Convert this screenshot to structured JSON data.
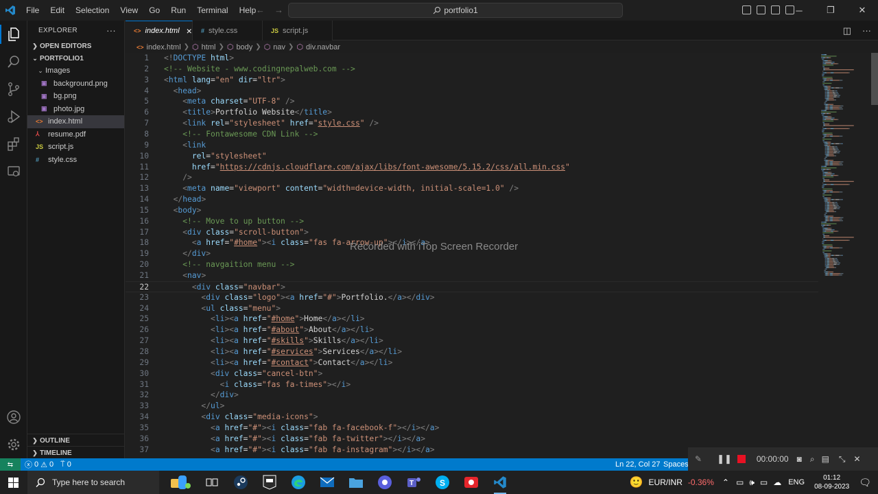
{
  "menu": [
    "File",
    "Edit",
    "Selection",
    "View",
    "Go",
    "Run",
    "Terminal",
    "Help"
  ],
  "command_center": "portfolio1",
  "explorer": {
    "title": "EXPLORER",
    "open_editors": "OPEN EDITORS",
    "project": "PORTFOLIO1",
    "folder": "Images",
    "files_in_folder": [
      "background.png",
      "bg.png",
      "photo.jpg"
    ],
    "files": [
      "index.html",
      "resume.pdf",
      "script.js",
      "style.css"
    ],
    "outline": "OUTLINE",
    "timeline": "TIMELINE"
  },
  "tabs": [
    {
      "label": "index.html",
      "icon": "<>",
      "close": "×"
    },
    {
      "label": "style.css",
      "icon": "#"
    },
    {
      "label": "script.js",
      "icon": "JS"
    }
  ],
  "breadcrumb": [
    "index.html",
    "html",
    "body",
    "nav",
    "div.navbar"
  ],
  "current_line": 22,
  "code": [
    [
      [
        "t",
        "<!"
      ],
      [
        "tg",
        "DOCTYPE"
      ],
      [
        "at",
        " html"
      ],
      [
        "t",
        ">"
      ]
    ],
    [
      [
        "c",
        "<!-- Website - www.codingnepalweb.com -->"
      ]
    ],
    [
      [
        "t",
        "<"
      ],
      [
        "tg",
        "html"
      ],
      [
        "at",
        " lang"
      ],
      [
        "d",
        "="
      ],
      [
        "s",
        "\"en\""
      ],
      [
        "at",
        " dir"
      ],
      [
        "d",
        "="
      ],
      [
        "s",
        "\"ltr\""
      ],
      [
        "t",
        ">"
      ]
    ],
    [
      [
        "d",
        "  "
      ],
      [
        "t",
        "<"
      ],
      [
        "tg",
        "head"
      ],
      [
        "t",
        ">"
      ]
    ],
    [
      [
        "d",
        "    "
      ],
      [
        "t",
        "<"
      ],
      [
        "tg",
        "meta"
      ],
      [
        "at",
        " charset"
      ],
      [
        "d",
        "="
      ],
      [
        "s",
        "\"UTF-8\""
      ],
      [
        "t",
        " />"
      ]
    ],
    [
      [
        "d",
        "    "
      ],
      [
        "t",
        "<"
      ],
      [
        "tg",
        "title"
      ],
      [
        "t",
        ">"
      ],
      [
        "d",
        "Portfolio Website"
      ],
      [
        "t",
        "</"
      ],
      [
        "tg",
        "title"
      ],
      [
        "t",
        ">"
      ]
    ],
    [
      [
        "d",
        "    "
      ],
      [
        "t",
        "<"
      ],
      [
        "tg",
        "link"
      ],
      [
        "at",
        " rel"
      ],
      [
        "d",
        "="
      ],
      [
        "s",
        "\"stylesheet\""
      ],
      [
        "at",
        " href"
      ],
      [
        "d",
        "="
      ],
      [
        "s",
        "\""
      ],
      [
        "su",
        "style.css"
      ],
      [
        "s",
        "\""
      ],
      [
        "t",
        " />"
      ]
    ],
    [
      [
        "d",
        "    "
      ],
      [
        "c",
        "<!-- Fontawesome CDN Link -->"
      ]
    ],
    [
      [
        "d",
        "    "
      ],
      [
        "t",
        "<"
      ],
      [
        "tg",
        "link"
      ]
    ],
    [
      [
        "d",
        "      "
      ],
      [
        "at",
        "rel"
      ],
      [
        "d",
        "="
      ],
      [
        "s",
        "\"stylesheet\""
      ]
    ],
    [
      [
        "d",
        "      "
      ],
      [
        "at",
        "href"
      ],
      [
        "d",
        "="
      ],
      [
        "s",
        "\""
      ],
      [
        "su",
        "https://cdnjs.cloudflare.com/ajax/libs/font-awesome/5.15.2/css/all.min.css"
      ],
      [
        "s",
        "\""
      ]
    ],
    [
      [
        "d",
        "    "
      ],
      [
        "t",
        "/>"
      ]
    ],
    [
      [
        "d",
        "    "
      ],
      [
        "t",
        "<"
      ],
      [
        "tg",
        "meta"
      ],
      [
        "at",
        " name"
      ],
      [
        "d",
        "="
      ],
      [
        "s",
        "\"viewport\""
      ],
      [
        "at",
        " content"
      ],
      [
        "d",
        "="
      ],
      [
        "s",
        "\"width=device-width, initial-scale=1.0\""
      ],
      [
        "t",
        " />"
      ]
    ],
    [
      [
        "d",
        "  "
      ],
      [
        "t",
        "</"
      ],
      [
        "tg",
        "head"
      ],
      [
        "t",
        ">"
      ]
    ],
    [
      [
        "d",
        "  "
      ],
      [
        "t",
        "<"
      ],
      [
        "tg",
        "body"
      ],
      [
        "t",
        ">"
      ]
    ],
    [
      [
        "d",
        "    "
      ],
      [
        "c",
        "<!-- Move to up button -->"
      ]
    ],
    [
      [
        "d",
        "    "
      ],
      [
        "t",
        "<"
      ],
      [
        "tg",
        "div"
      ],
      [
        "at",
        " class"
      ],
      [
        "d",
        "="
      ],
      [
        "s",
        "\"scroll-button\""
      ],
      [
        "t",
        ">"
      ]
    ],
    [
      [
        "d",
        "      "
      ],
      [
        "t",
        "<"
      ],
      [
        "tg",
        "a"
      ],
      [
        "at",
        " href"
      ],
      [
        "d",
        "="
      ],
      [
        "s",
        "\""
      ],
      [
        "su",
        "#home"
      ],
      [
        "s",
        "\""
      ],
      [
        "t",
        "><"
      ],
      [
        "tg",
        "i"
      ],
      [
        "at",
        " class"
      ],
      [
        "d",
        "="
      ],
      [
        "s",
        "\"fas fa-arrow-up\""
      ],
      [
        "t",
        "></"
      ],
      [
        "tg",
        "i"
      ],
      [
        "t",
        "></"
      ],
      [
        "tg",
        "a"
      ],
      [
        "t",
        ">"
      ]
    ],
    [
      [
        "d",
        "    "
      ],
      [
        "t",
        "</"
      ],
      [
        "tg",
        "div"
      ],
      [
        "t",
        ">"
      ]
    ],
    [
      [
        "d",
        "    "
      ],
      [
        "c",
        "<!-- navgaition menu -->"
      ]
    ],
    [
      [
        "d",
        "    "
      ],
      [
        "t",
        "<"
      ],
      [
        "tg",
        "nav"
      ],
      [
        "t",
        ">"
      ]
    ],
    [
      [
        "d",
        "      "
      ],
      [
        "t",
        "<"
      ],
      [
        "tg",
        "div"
      ],
      [
        "at",
        " class"
      ],
      [
        "d",
        "="
      ],
      [
        "s",
        "\"navbar\""
      ],
      [
        "t",
        ">"
      ]
    ],
    [
      [
        "d",
        "        "
      ],
      [
        "t",
        "<"
      ],
      [
        "tg",
        "div"
      ],
      [
        "at",
        " class"
      ],
      [
        "d",
        "="
      ],
      [
        "s",
        "\"logo\""
      ],
      [
        "t",
        "><"
      ],
      [
        "tg",
        "a"
      ],
      [
        "at",
        " href"
      ],
      [
        "d",
        "="
      ],
      [
        "s",
        "\"#\""
      ],
      [
        "t",
        ">"
      ],
      [
        "d",
        "Portfolio."
      ],
      [
        "t",
        "</"
      ],
      [
        "tg",
        "a"
      ],
      [
        "t",
        "></"
      ],
      [
        "tg",
        "div"
      ],
      [
        "t",
        ">"
      ]
    ],
    [
      [
        "d",
        "        "
      ],
      [
        "t",
        "<"
      ],
      [
        "tg",
        "ul"
      ],
      [
        "at",
        " class"
      ],
      [
        "d",
        "="
      ],
      [
        "s",
        "\"menu\""
      ],
      [
        "t",
        ">"
      ]
    ],
    [
      [
        "d",
        "          "
      ],
      [
        "t",
        "<"
      ],
      [
        "tg",
        "li"
      ],
      [
        "t",
        "><"
      ],
      [
        "tg",
        "a"
      ],
      [
        "at",
        " href"
      ],
      [
        "d",
        "="
      ],
      [
        "s",
        "\""
      ],
      [
        "su",
        "#home"
      ],
      [
        "s",
        "\""
      ],
      [
        "t",
        ">"
      ],
      [
        "d",
        "Home"
      ],
      [
        "t",
        "</"
      ],
      [
        "tg",
        "a"
      ],
      [
        "t",
        "></"
      ],
      [
        "tg",
        "li"
      ],
      [
        "t",
        ">"
      ]
    ],
    [
      [
        "d",
        "          "
      ],
      [
        "t",
        "<"
      ],
      [
        "tg",
        "li"
      ],
      [
        "t",
        "><"
      ],
      [
        "tg",
        "a"
      ],
      [
        "at",
        " href"
      ],
      [
        "d",
        "="
      ],
      [
        "s",
        "\""
      ],
      [
        "su",
        "#about"
      ],
      [
        "s",
        "\""
      ],
      [
        "t",
        ">"
      ],
      [
        "d",
        "About"
      ],
      [
        "t",
        "</"
      ],
      [
        "tg",
        "a"
      ],
      [
        "t",
        "></"
      ],
      [
        "tg",
        "li"
      ],
      [
        "t",
        ">"
      ]
    ],
    [
      [
        "d",
        "          "
      ],
      [
        "t",
        "<"
      ],
      [
        "tg",
        "li"
      ],
      [
        "t",
        "><"
      ],
      [
        "tg",
        "a"
      ],
      [
        "at",
        " href"
      ],
      [
        "d",
        "="
      ],
      [
        "s",
        "\""
      ],
      [
        "su",
        "#skills"
      ],
      [
        "s",
        "\""
      ],
      [
        "t",
        ">"
      ],
      [
        "d",
        "Skills"
      ],
      [
        "t",
        "</"
      ],
      [
        "tg",
        "a"
      ],
      [
        "t",
        "></"
      ],
      [
        "tg",
        "li"
      ],
      [
        "t",
        ">"
      ]
    ],
    [
      [
        "d",
        "          "
      ],
      [
        "t",
        "<"
      ],
      [
        "tg",
        "li"
      ],
      [
        "t",
        "><"
      ],
      [
        "tg",
        "a"
      ],
      [
        "at",
        " href"
      ],
      [
        "d",
        "="
      ],
      [
        "s",
        "\""
      ],
      [
        "su",
        "#services"
      ],
      [
        "s",
        "\""
      ],
      [
        "t",
        ">"
      ],
      [
        "d",
        "Services"
      ],
      [
        "t",
        "</"
      ],
      [
        "tg",
        "a"
      ],
      [
        "t",
        "></"
      ],
      [
        "tg",
        "li"
      ],
      [
        "t",
        ">"
      ]
    ],
    [
      [
        "d",
        "          "
      ],
      [
        "t",
        "<"
      ],
      [
        "tg",
        "li"
      ],
      [
        "t",
        "><"
      ],
      [
        "tg",
        "a"
      ],
      [
        "at",
        " href"
      ],
      [
        "d",
        "="
      ],
      [
        "s",
        "\""
      ],
      [
        "su",
        "#contact"
      ],
      [
        "s",
        "\""
      ],
      [
        "t",
        ">"
      ],
      [
        "d",
        "Contact"
      ],
      [
        "t",
        "</"
      ],
      [
        "tg",
        "a"
      ],
      [
        "t",
        "></"
      ],
      [
        "tg",
        "li"
      ],
      [
        "t",
        ">"
      ]
    ],
    [
      [
        "d",
        "          "
      ],
      [
        "t",
        "<"
      ],
      [
        "tg",
        "div"
      ],
      [
        "at",
        " class"
      ],
      [
        "d",
        "="
      ],
      [
        "s",
        "\"cancel-btn\""
      ],
      [
        "t",
        ">"
      ]
    ],
    [
      [
        "d",
        "            "
      ],
      [
        "t",
        "<"
      ],
      [
        "tg",
        "i"
      ],
      [
        "at",
        " class"
      ],
      [
        "d",
        "="
      ],
      [
        "s",
        "\"fas fa-times\""
      ],
      [
        "t",
        "></"
      ],
      [
        "tg",
        "i"
      ],
      [
        "t",
        ">"
      ]
    ],
    [
      [
        "d",
        "          "
      ],
      [
        "t",
        "</"
      ],
      [
        "tg",
        "div"
      ],
      [
        "t",
        ">"
      ]
    ],
    [
      [
        "d",
        "        "
      ],
      [
        "t",
        "</"
      ],
      [
        "tg",
        "ul"
      ],
      [
        "t",
        ">"
      ]
    ],
    [
      [
        "d",
        "        "
      ],
      [
        "t",
        "<"
      ],
      [
        "tg",
        "div"
      ],
      [
        "at",
        " class"
      ],
      [
        "d",
        "="
      ],
      [
        "s",
        "\"media-icons\""
      ],
      [
        "t",
        ">"
      ]
    ],
    [
      [
        "d",
        "          "
      ],
      [
        "t",
        "<"
      ],
      [
        "tg",
        "a"
      ],
      [
        "at",
        " href"
      ],
      [
        "d",
        "="
      ],
      [
        "s",
        "\"#\""
      ],
      [
        "t",
        "><"
      ],
      [
        "tg",
        "i"
      ],
      [
        "at",
        " class"
      ],
      [
        "d",
        "="
      ],
      [
        "s",
        "\"fab fa-facebook-f\""
      ],
      [
        "t",
        "></"
      ],
      [
        "tg",
        "i"
      ],
      [
        "t",
        "></"
      ],
      [
        "tg",
        "a"
      ],
      [
        "t",
        ">"
      ]
    ],
    [
      [
        "d",
        "          "
      ],
      [
        "t",
        "<"
      ],
      [
        "tg",
        "a"
      ],
      [
        "at",
        " href"
      ],
      [
        "d",
        "="
      ],
      [
        "s",
        "\"#\""
      ],
      [
        "t",
        "><"
      ],
      [
        "tg",
        "i"
      ],
      [
        "at",
        " class"
      ],
      [
        "d",
        "="
      ],
      [
        "s",
        "\"fab fa-twitter\""
      ],
      [
        "t",
        "></"
      ],
      [
        "tg",
        "i"
      ],
      [
        "t",
        "></"
      ],
      [
        "tg",
        "a"
      ],
      [
        "t",
        ">"
      ]
    ],
    [
      [
        "d",
        "          "
      ],
      [
        "t",
        "<"
      ],
      [
        "tg",
        "a"
      ],
      [
        "at",
        " href"
      ],
      [
        "d",
        "="
      ],
      [
        "s",
        "\"#\""
      ],
      [
        "t",
        "><"
      ],
      [
        "tg",
        "i"
      ],
      [
        "at",
        " class"
      ],
      [
        "d",
        "="
      ],
      [
        "s",
        "\"fab fa-instagram\""
      ],
      [
        "t",
        "></"
      ],
      [
        "tg",
        "i"
      ],
      [
        "t",
        "></"
      ],
      [
        "tg",
        "a"
      ],
      [
        "t",
        ">"
      ]
    ]
  ],
  "watermark": "Recorded with iTop Screen Recorder",
  "status": {
    "errors": "0",
    "warnings": "0",
    "ports": "0",
    "position": "Ln 22, Col 27",
    "spaces": "Spaces: 2"
  },
  "recorder": {
    "time": "00:00:00"
  },
  "taskbar": {
    "search_placeholder": "Type here to search",
    "ticker_name": "EUR/INR",
    "ticker_change": "-0.36%",
    "language": "ENG",
    "time": "01:12",
    "date": "08-09-2023"
  },
  "colors": {
    "accent": "#0078d4",
    "statusbar": "#007acc",
    "remote": "#16825d",
    "negative": "#ff6b6b"
  }
}
